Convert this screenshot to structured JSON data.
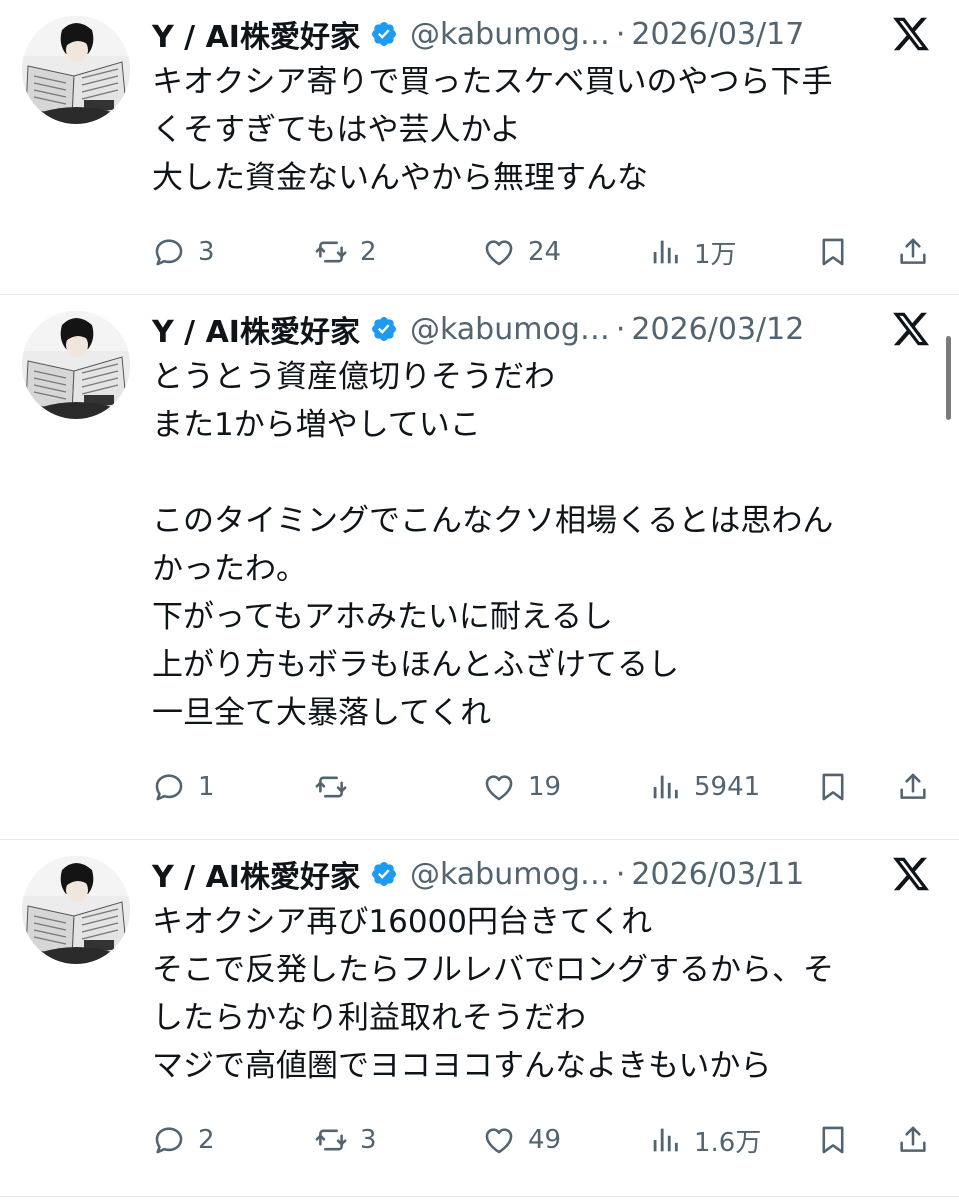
{
  "tweets": [
    {
      "author_name": "Y / AI株愛好家",
      "handle": "@kabumog…",
      "separator": "·",
      "date": "2026/03/17",
      "lines": [
        "キオクシア寄りで買ったスケベ買いのやつら下手",
        "くそすぎてもはや芸人かよ",
        "大した資金ないんやから無理すんな"
      ],
      "replies": "3",
      "retweets": "2",
      "likes": "24",
      "views": "1万"
    },
    {
      "author_name": "Y / AI株愛好家",
      "handle": "@kabumog…",
      "separator": "·",
      "date": "2026/03/12",
      "lines": [
        "とうとう資産億切りそうだわ",
        "また1から増やしていこ",
        "",
        "このタイミングでこんなクソ相場くるとは思わん",
        "かったわ。",
        "下がってもアホみたいに耐えるし",
        "上がり方もボラもほんとふざけてるし",
        "一旦全て大暴落してくれ"
      ],
      "replies": "1",
      "retweets": "",
      "likes": "19",
      "views": "5941"
    },
    {
      "author_name": "Y / AI株愛好家",
      "handle": "@kabumog…",
      "separator": "·",
      "date": "2026/03/11",
      "lines": [
        "キオクシア再び16000円台きてくれ",
        "そこで反発したらフルレバでロングするから、そ",
        "したらかなり利益取れそうだわ",
        "マジで高値圏でヨコヨコすんなよきもいから"
      ],
      "replies": "2",
      "retweets": "3",
      "likes": "49",
      "views": "1.6万"
    }
  ],
  "icons": {
    "verified": "verified-badge-icon",
    "platform": "x-logo-icon",
    "reply": "reply-icon",
    "retweet": "retweet-icon",
    "like": "heart-icon",
    "views": "views-icon",
    "bookmark": "bookmark-icon",
    "share": "share-icon"
  },
  "colors": {
    "verified": "#1d9bf0",
    "text": "#0f1419",
    "secondary": "#536471",
    "divider": "#e6e9ec"
  }
}
